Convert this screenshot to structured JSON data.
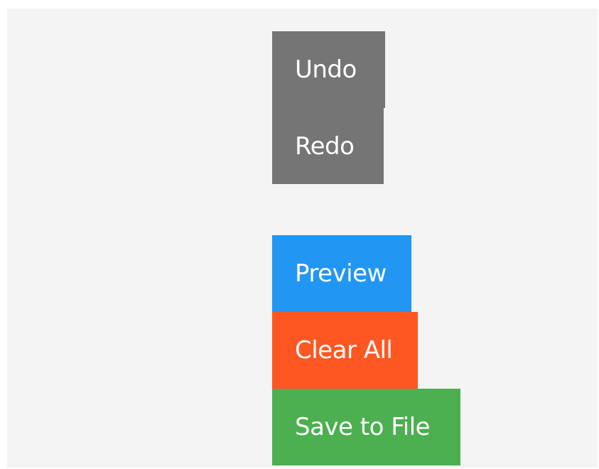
{
  "toolbar": {
    "undo_label": "Undo",
    "redo_label": "Redo",
    "preview_label": "Preview",
    "clear_label": "Clear All",
    "save_label": "Save to File"
  },
  "colors": {
    "background": "#f4f4f4",
    "history_button": "#757575",
    "preview_button": "#2196f3",
    "clear_button": "#ff5722",
    "save_button": "#4caf50",
    "button_text": "#ffffff"
  }
}
